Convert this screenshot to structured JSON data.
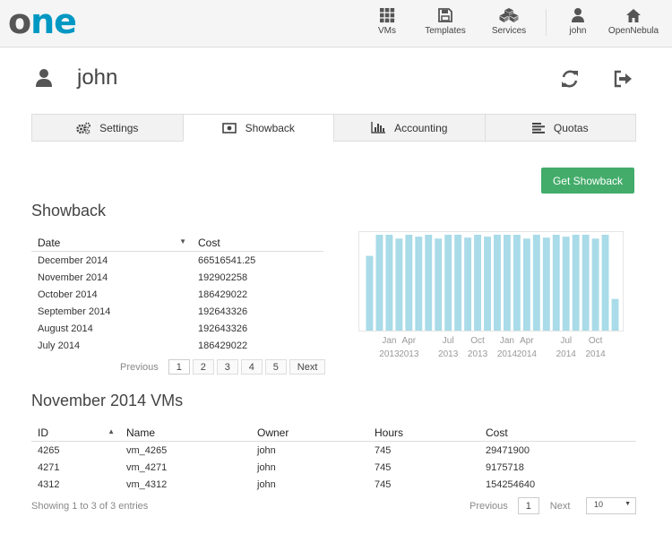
{
  "topbar": {
    "logo_o": "o",
    "logo_ne": "ne",
    "nav": [
      {
        "label": "VMs",
        "icon": "grid-icon"
      },
      {
        "label": "Templates",
        "icon": "save-icon"
      },
      {
        "label": "Services",
        "icon": "cubes-icon"
      },
      {
        "label": "john",
        "icon": "user-icon"
      },
      {
        "label": "OpenNebula",
        "icon": "home-icon"
      }
    ]
  },
  "user": {
    "name": "john"
  },
  "tabs": [
    {
      "label": "Settings",
      "icon": "gears-icon"
    },
    {
      "label": "Showback",
      "icon": "money-icon",
      "active": true
    },
    {
      "label": "Accounting",
      "icon": "bar-chart-icon"
    },
    {
      "label": "Quotas",
      "icon": "align-left-icon"
    }
  ],
  "get_showback_label": "Get Showback",
  "showback": {
    "title": "Showback",
    "headers": [
      "Date",
      "Cost"
    ],
    "rows": [
      [
        "December 2014",
        "66516541.25"
      ],
      [
        "November 2014",
        "192902258"
      ],
      [
        "October 2014",
        "186429022"
      ],
      [
        "September 2014",
        "192643326"
      ],
      [
        "August 2014",
        "192643326"
      ],
      [
        "July 2014",
        "186429022"
      ]
    ],
    "pager": {
      "previous": "Previous",
      "pages": [
        "1",
        "2",
        "3",
        "4",
        "5"
      ],
      "next": "Next"
    }
  },
  "chart_data": {
    "type": "bar",
    "bar_color": "#a9dbe8",
    "values": [
      0.78,
      1.0,
      1.0,
      0.96,
      1.0,
      0.98,
      1.0,
      0.96,
      1.0,
      1.0,
      0.97,
      1.0,
      0.98,
      1.0,
      1.0,
      1.0,
      0.96,
      1.0,
      0.97,
      1.0,
      0.98,
      1.0,
      1.0,
      0.96,
      1.0,
      0.33
    ],
    "ylim": [
      0,
      1
    ],
    "tick_labels": [
      {
        "bar": 2,
        "month": "Jan",
        "year": "2013"
      },
      {
        "bar": 4,
        "month": "Apr",
        "year": "2013"
      },
      {
        "bar": 8,
        "month": "Jul",
        "year": "2013"
      },
      {
        "bar": 11,
        "month": "Oct",
        "year": "2013"
      },
      {
        "bar": 14,
        "month": "Jan",
        "year": "2014"
      },
      {
        "bar": 16,
        "month": "Apr",
        "year": "2014"
      },
      {
        "bar": 20,
        "month": "Jul",
        "year": "2014"
      },
      {
        "bar": 23,
        "month": "Oct",
        "year": "2014"
      }
    ]
  },
  "vms": {
    "title": "November 2014 VMs",
    "headers": [
      "ID",
      "Name",
      "Owner",
      "Hours",
      "Cost"
    ],
    "rows": [
      [
        "4265",
        "vm_4265",
        "john",
        "745",
        "29471900"
      ],
      [
        "4271",
        "vm_4271",
        "john",
        "745",
        "9175718"
      ],
      [
        "4312",
        "vm_4312",
        "john",
        "745",
        "154254640"
      ]
    ],
    "info": "Showing 1 to 3 of 3 entries",
    "pager": {
      "previous": "Previous",
      "page": "1",
      "next": "Next"
    },
    "page_size": "10"
  }
}
